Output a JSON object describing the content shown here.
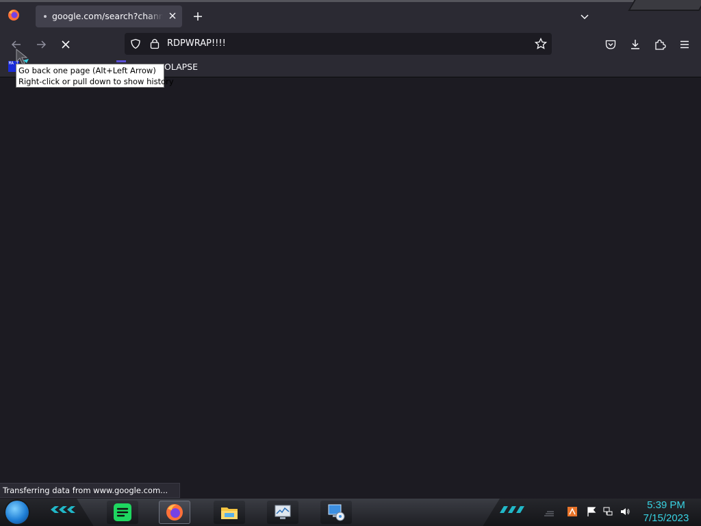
{
  "browser": {
    "tab": {
      "title": "google.com/search?channel=fs"
    },
    "nav": {
      "url_text": "RDPWRAP!!!!"
    },
    "bookmarks": {
      "favicon_text": "MA T",
      "label": "OLAPSE"
    },
    "tooltip": {
      "line1": "Go back one page (Alt+Left Arrow)",
      "line2": "Right-click or pull down to show history"
    },
    "status": "Transferring data from www.google.com..."
  },
  "taskbar": {
    "apps": [
      {
        "name": "Spotify"
      },
      {
        "name": "Firefox"
      },
      {
        "name": "File Explorer"
      },
      {
        "name": "Task Manager"
      },
      {
        "name": "Remote Desktop"
      }
    ],
    "clock": {
      "time": "5:39 PM",
      "date": "7/15/2023"
    }
  },
  "colors": {
    "accent_cyan": "#38d3e3",
    "toolbar_bg": "#2b2a33",
    "content_bg": "#1c1b22"
  }
}
